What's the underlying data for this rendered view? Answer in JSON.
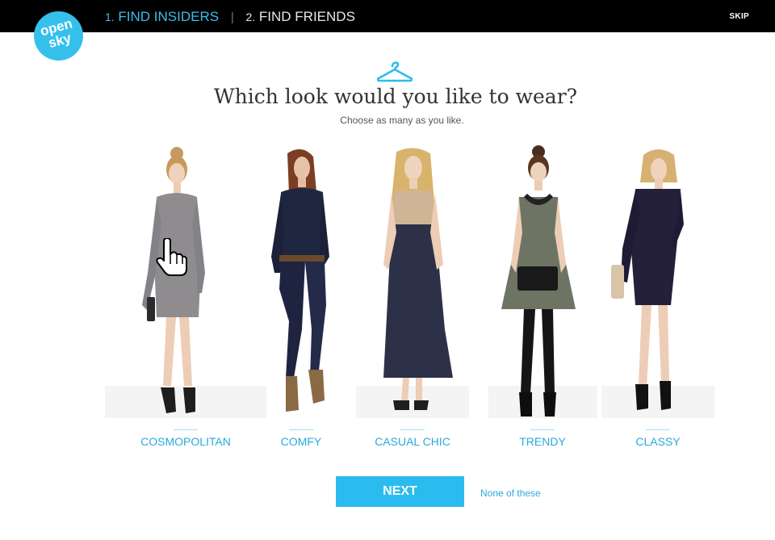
{
  "header": {
    "logo_line1": "open",
    "logo_line2": "sky",
    "step1_num": "1.",
    "step1_label": "FIND INSIDERS",
    "step_separator": "|",
    "step2_num": "2.",
    "step2_label": "FIND FRIENDS",
    "skip": "SKIP"
  },
  "main": {
    "icon": "hanger-icon",
    "question": "Which look would you like to wear?",
    "subtitle": "Choose as many as you like."
  },
  "looks": [
    {
      "label": "COSMOPOLITAN"
    },
    {
      "label": "COMFY"
    },
    {
      "label": "CASUAL CHIC"
    },
    {
      "label": "TRENDY"
    },
    {
      "label": "CLASSY"
    }
  ],
  "actions": {
    "next": "NEXT",
    "none": "None of these"
  },
  "colors": {
    "accent": "#2bbcef",
    "topbar": "#000000",
    "link": "#2aa9dd"
  }
}
